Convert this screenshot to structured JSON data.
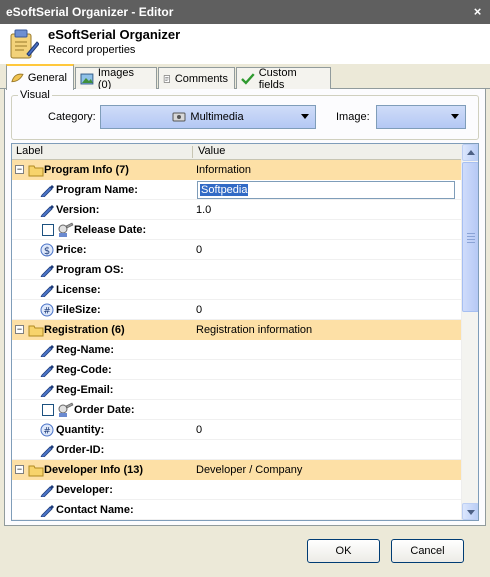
{
  "window": {
    "title": "eSoftSerial Organizer - Editor",
    "close_label": "×"
  },
  "header": {
    "title": "eSoftSerial Organizer",
    "subtitle": "Record properties"
  },
  "tabs": [
    {
      "label": "General",
      "icon": "general-icon",
      "active": true
    },
    {
      "label": "Images (0)",
      "icon": "images-icon"
    },
    {
      "label": "Comments",
      "icon": "comments-icon"
    },
    {
      "label": "Custom fields",
      "icon": "checkmark-icon"
    }
  ],
  "visual": {
    "legend": "Visual",
    "category_label": "Category:",
    "category_value": "Multimedia",
    "image_label": "Image:",
    "image_value": ""
  },
  "grid": {
    "columns": [
      "Label",
      "Value"
    ],
    "rows": [
      {
        "type": "category",
        "label": "Program Info (7)",
        "value": "Information"
      },
      {
        "type": "field",
        "icon": "pen-icon",
        "label": "Program Name:",
        "value": "Softpedia",
        "editing": true
      },
      {
        "type": "field",
        "icon": "pen-icon",
        "label": "Version:",
        "value": "1.0"
      },
      {
        "type": "date",
        "icon": "calendar-icon",
        "label": "Release Date:",
        "value": ""
      },
      {
        "type": "field",
        "icon": "dollar-icon",
        "label": "Price:",
        "value": "0"
      },
      {
        "type": "field",
        "icon": "pen-icon",
        "label": "Program OS:",
        "value": ""
      },
      {
        "type": "field",
        "icon": "pen-icon",
        "label": "License:",
        "value": ""
      },
      {
        "type": "field",
        "icon": "number-icon",
        "label": "FileSize:",
        "value": "0"
      },
      {
        "type": "category",
        "label": "Registration (6)",
        "value": "Registration information"
      },
      {
        "type": "field",
        "icon": "pen-icon",
        "label": "Reg-Name:",
        "value": ""
      },
      {
        "type": "field",
        "icon": "pen-icon",
        "label": "Reg-Code:",
        "value": ""
      },
      {
        "type": "field",
        "icon": "pen-icon",
        "label": "Reg-Email:",
        "value": ""
      },
      {
        "type": "date",
        "icon": "calendar-icon",
        "label": "Order Date:",
        "value": ""
      },
      {
        "type": "field",
        "icon": "number-icon",
        "label": "Quantity:",
        "value": "0"
      },
      {
        "type": "field",
        "icon": "pen-icon",
        "label": "Order-ID:",
        "value": ""
      },
      {
        "type": "category",
        "label": "Developer Info (13)",
        "value": "Developer / Company"
      },
      {
        "type": "field",
        "icon": "pen-icon",
        "label": "Developer:",
        "value": ""
      },
      {
        "type": "field",
        "icon": "pen-icon",
        "label": "Contact Name:",
        "value": ""
      }
    ]
  },
  "buttons": {
    "ok": "OK",
    "cancel": "Cancel"
  },
  "colors": {
    "category_row": "#fde0a6",
    "title_bar": "#5f5f5f",
    "combo": "#b4c8f4",
    "selection": "#316ac5"
  }
}
